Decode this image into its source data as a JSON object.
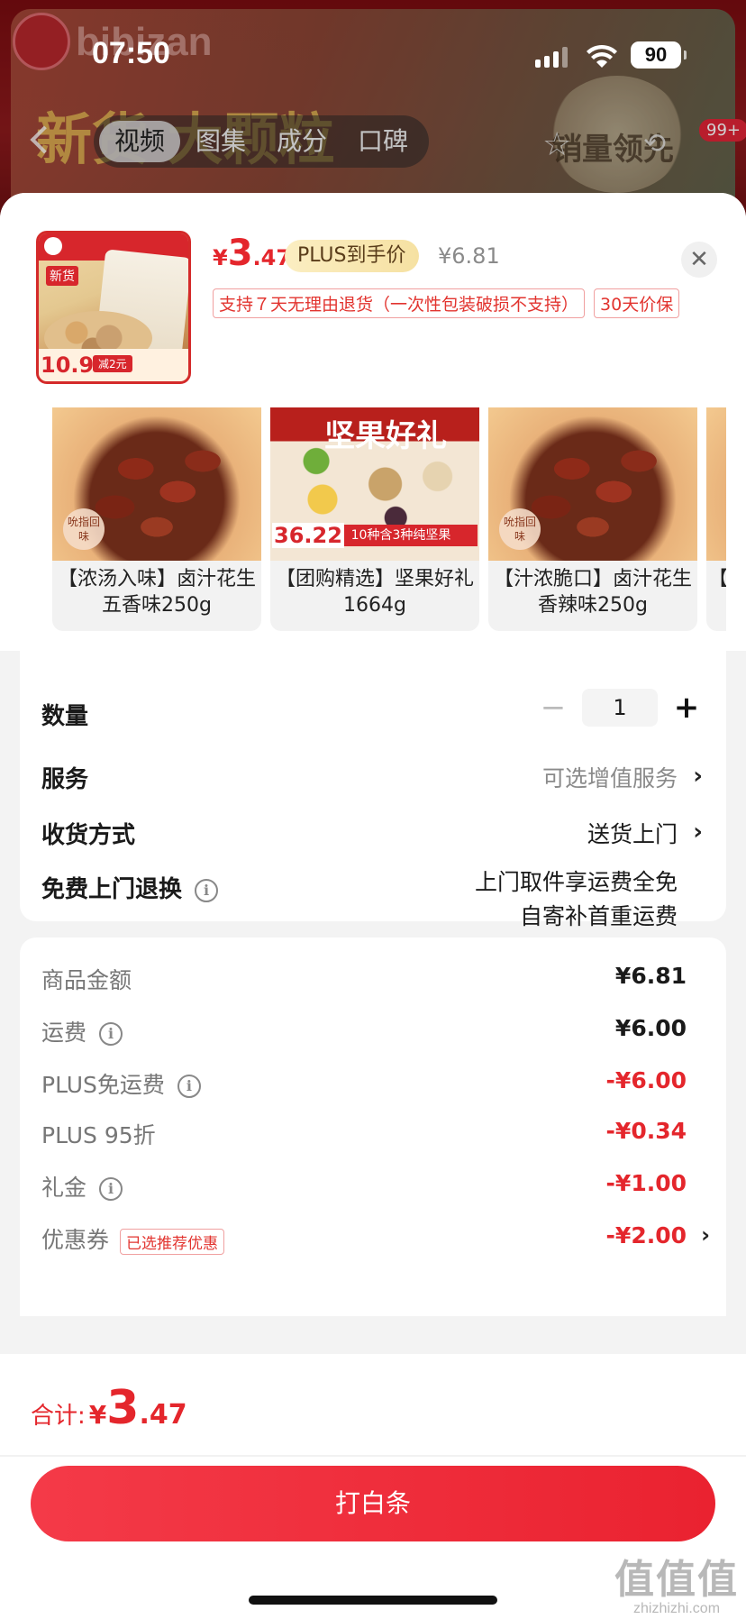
{
  "status_bar": {
    "time": "07:50",
    "battery": "90"
  },
  "background": {
    "brand": "bibizan",
    "headline": "新货 大颗粒",
    "medal_text": "销量领先",
    "badge": "99+",
    "media_tabs": [
      "视频",
      "图集",
      "成分",
      "口碑"
    ],
    "active_media_tab": "视频"
  },
  "product": {
    "price_symbol": "¥",
    "price_int": "3",
    "price_dec": ".47",
    "plus_label": "PLUS到手价",
    "original_price": "¥6.81",
    "tags": [
      "支持７天无理由退货（一次性包装破损不支持）",
      "30天价保"
    ],
    "thumb": {
      "label": "新货",
      "price": "10.9",
      "promo": "减2元"
    },
    "close_icon": "close-icon"
  },
  "recommendations": [
    {
      "name_line1": "【浓汤入味】卤汁花生",
      "name_line2": "五香味250g",
      "badge": "吮指回味",
      "img": "peanut"
    },
    {
      "name_line1": "【团购精选】坚果好礼",
      "name_line2": "1664g",
      "price": "36.22",
      "banner": "10种含3种纯坚果",
      "title": "坚果好礼",
      "img": "nuts"
    },
    {
      "name_line1": "【汁浓脆口】卤汁花生",
      "name_line2": "香辣味250g",
      "badge": "吮指回味",
      "img": "peanut"
    },
    {
      "name_line1": "【团",
      "name_line2": "",
      "img": "peanut"
    }
  ],
  "options": {
    "quantity": {
      "label": "数量",
      "value": "1",
      "minus": "−",
      "plus": "+"
    },
    "service": {
      "label": "服务",
      "value": "可选增值服务"
    },
    "delivery": {
      "label": "收货方式",
      "value": "送货上门"
    },
    "free_return": {
      "label": "免费上门退换",
      "line1": "上门取件享运费全免",
      "line2": "自寄补首重运费"
    }
  },
  "breakdown": {
    "goods": {
      "label": "商品金额",
      "value": "¥6.81"
    },
    "shipping": {
      "label": "运费",
      "value": "¥6.00"
    },
    "plus_free_shipping": {
      "label": "PLUS免运费",
      "value": "-¥6.00"
    },
    "plus_discount": {
      "label": "PLUS 95折",
      "value": "-¥0.34"
    },
    "gift": {
      "label": "礼金",
      "value": "-¥1.00"
    },
    "coupon": {
      "label": "优惠券",
      "chip": "已选推荐优惠",
      "value": "-¥2.00"
    }
  },
  "footer": {
    "total_label": "合计:",
    "total_symbol": "¥",
    "total_int": "3",
    "total_dec": ".47",
    "pay_button": "打白条"
  },
  "watermark": {
    "big": "值值值",
    "small": "zhizhizhi.com"
  },
  "colors": {
    "accent": "#e4262c",
    "button": "#f43a48",
    "plus_chip": "#fbeec2"
  }
}
